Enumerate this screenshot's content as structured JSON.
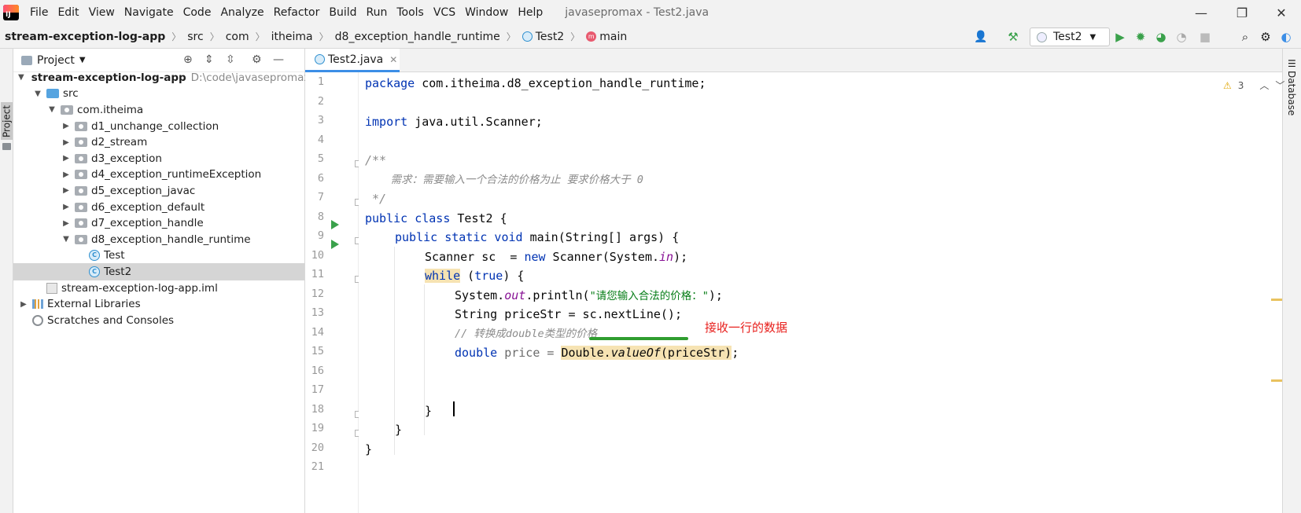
{
  "app": {
    "title": "javasepromax - Test2.java",
    "logo_text": "IJ"
  },
  "menu": [
    {
      "label": "File"
    },
    {
      "label": "Edit"
    },
    {
      "label": "View"
    },
    {
      "label": "Navigate"
    },
    {
      "label": "Code"
    },
    {
      "label": "Analyze"
    },
    {
      "label": "Refactor"
    },
    {
      "label": "Build"
    },
    {
      "label": "Run"
    },
    {
      "label": "Tools"
    },
    {
      "label": "VCS"
    },
    {
      "label": "Window"
    },
    {
      "label": "Help"
    }
  ],
  "window_controls": {
    "minimize": "—",
    "restore": "❐",
    "close": "✕"
  },
  "breadcrumb": [
    {
      "label": "stream-exception-log-app"
    },
    {
      "label": "src"
    },
    {
      "label": "com"
    },
    {
      "label": "itheima"
    },
    {
      "label": "d8_exception_handle_runtime"
    },
    {
      "label": "Test2"
    },
    {
      "label": "main"
    }
  ],
  "run_config": {
    "label": "Test2"
  },
  "left_strip": {
    "project_tab": "Project"
  },
  "right_strip": {
    "database_tab": "Database"
  },
  "project_panel": {
    "title": "Project",
    "tree": [
      {
        "label": "stream-exception-log-app",
        "path": "D:\\code\\javasepromax\\"
      },
      {
        "label": "src"
      },
      {
        "label": "com.itheima"
      },
      {
        "label": "d1_unchange_collection"
      },
      {
        "label": "d2_stream"
      },
      {
        "label": "d3_exception"
      },
      {
        "label": "d4_exception_runtimeException"
      },
      {
        "label": "d5_exception_javac"
      },
      {
        "label": "d6_exception_default"
      },
      {
        "label": "d7_exception_handle"
      },
      {
        "label": "d8_exception_handle_runtime"
      },
      {
        "label": "Test"
      },
      {
        "label": "Test2"
      },
      {
        "label": "stream-exception-log-app.iml"
      },
      {
        "label": "External Libraries"
      },
      {
        "label": "Scratches and Consoles"
      }
    ]
  },
  "editor": {
    "tab": {
      "label": "Test2.java"
    },
    "warnings": "3",
    "line_numbers": [
      "1",
      "2",
      "3",
      "4",
      "5",
      "6",
      "7",
      "8",
      "9",
      "10",
      "11",
      "12",
      "13",
      "14",
      "15",
      "16",
      "17",
      "18",
      "19",
      "20",
      "21"
    ],
    "annotation": "接收一行的数据",
    "code": {
      "l1": [
        "package",
        " com.itheima.d8_exception_handle_runtime;"
      ],
      "l3": [
        "import",
        " java.util.Scanner;"
      ],
      "l5": "/**",
      "l6": "    需求：需要输入一个合法的价格为止 要求价格大于 0",
      "l7": " */",
      "l8": [
        "public class",
        " Test2 {"
      ],
      "l9": [
        "public static void",
        " main(String[] args) {"
      ],
      "l10": [
        "Scanner sc  = ",
        "new",
        " Scanner(System.",
        "in",
        ");"
      ],
      "l11": [
        "while",
        " (",
        "true",
        ") {"
      ],
      "l12": [
        "System.",
        "out",
        ".println(",
        "\"请您输入合法的价格：\"",
        ");"
      ],
      "l13": "String priceStr = sc.nextLine();",
      "l14": "// 转换成double类型的价格",
      "l15": [
        "double",
        " price = ",
        "Double.",
        "valueOf",
        "(priceStr)",
        ";"
      ],
      "l18": "}",
      "l19": "}",
      "l20": "}"
    }
  }
}
